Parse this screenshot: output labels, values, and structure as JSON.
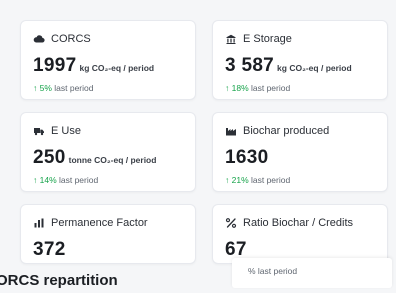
{
  "cards": [
    {
      "title": "CORCS",
      "icon": "cloud-icon",
      "value": "1997",
      "unit": "kg CO₂-eq / period",
      "trend_pct": "↑ 5%",
      "trend_text": " last period"
    },
    {
      "title": "E Storage",
      "icon": "storage-icon",
      "value": "3 587",
      "unit": "kg CO₂-eq / period",
      "trend_pct": "↑ 18%",
      "trend_text": " last period"
    },
    {
      "title": "E Use",
      "icon": "truck-icon",
      "value": "250",
      "unit": "tonne CO₂-eq / period",
      "trend_pct": "↑ 14%",
      "trend_text": " last period"
    },
    {
      "title": "Biochar produced",
      "icon": "factory-icon",
      "value": "1630",
      "unit": "",
      "trend_pct": "↑ 21%",
      "trend_text": " last period"
    },
    {
      "title": "Permanence Factor",
      "icon": "bar-chart-icon",
      "value": "372",
      "unit": "",
      "trend_pct": "",
      "trend_text": ""
    },
    {
      "title": "Ratio Biochar / Credits",
      "icon": "percent-icon",
      "value": "67",
      "unit": "",
      "trend_pct": "",
      "trend_text": ""
    }
  ],
  "overlay": {
    "text": "% last period"
  },
  "section": {
    "title": "ORCS repartition"
  },
  "colors": {
    "trend_up": "#16a34a",
    "card_border": "#e7e9ee",
    "background": "#f5f6f8"
  }
}
